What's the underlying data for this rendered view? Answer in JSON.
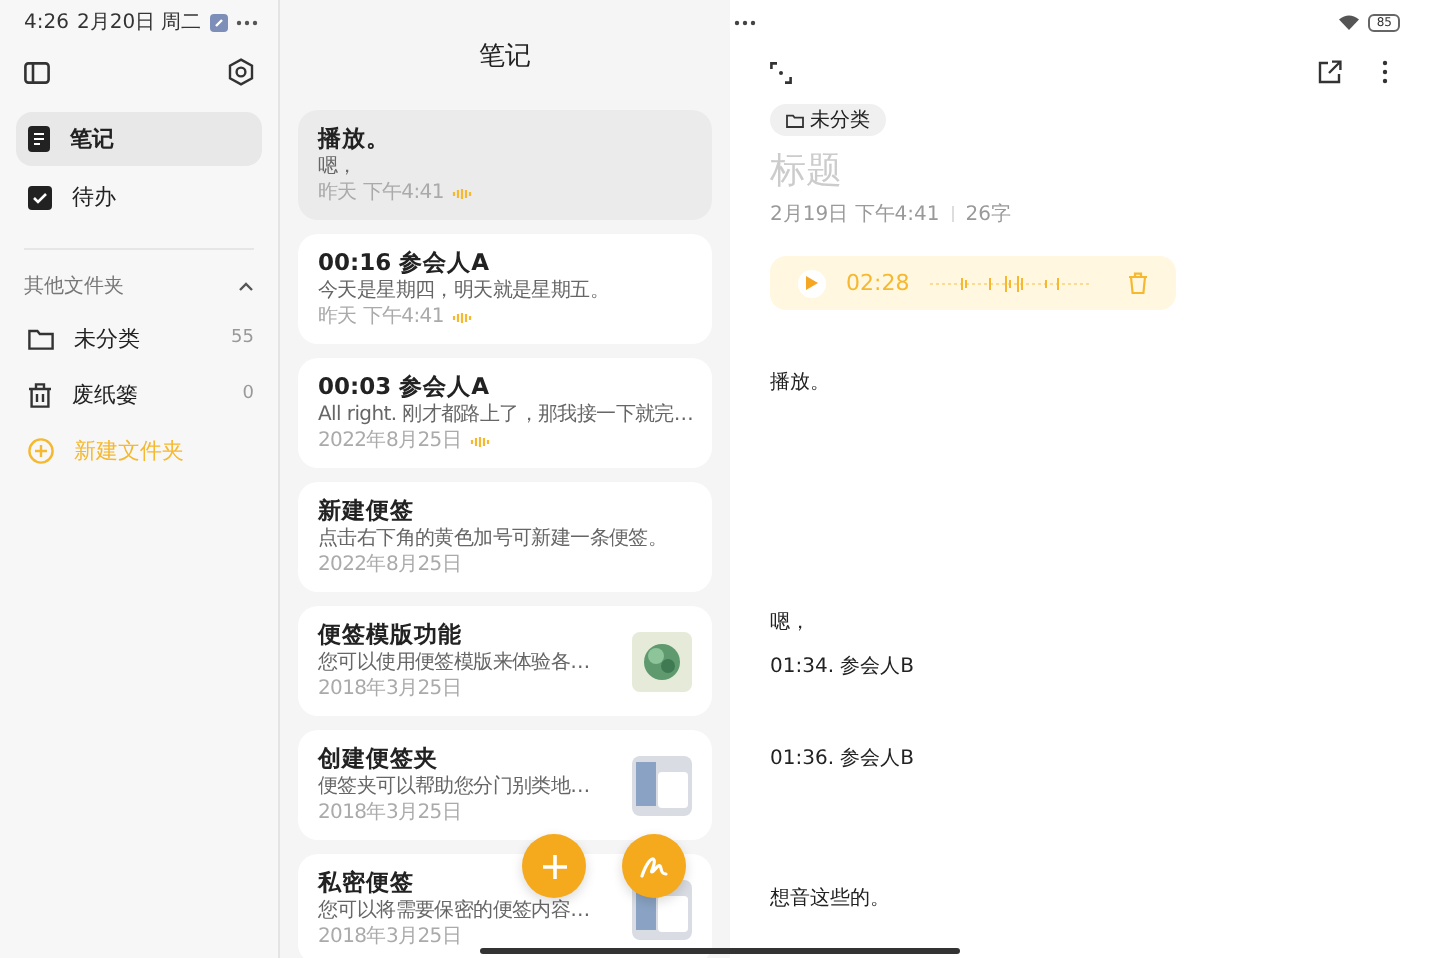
{
  "status_bar": {
    "time": "4:26",
    "date": "2月20日 周二",
    "battery": "85"
  },
  "sidebar": {
    "items": [
      {
        "label": "笔记",
        "kind": "note",
        "selected": true
      },
      {
        "label": "待办",
        "kind": "todo",
        "selected": false
      }
    ],
    "folders_header": {
      "label": "其他文件夹",
      "expanded": true
    },
    "folders": [
      {
        "label": "未分类",
        "count": "55",
        "kind": "folder"
      },
      {
        "label": "废纸篓",
        "count": "0",
        "kind": "trash"
      }
    ],
    "new_folder": "新建文件夹"
  },
  "list": {
    "title": "笔记",
    "notes": [
      {
        "title": "播放。",
        "preview": "嗯，",
        "date": "昨天 下午4:41",
        "audio": true,
        "selected": true
      },
      {
        "title": "00:16 参会人A",
        "preview": "今天是星期四，明天就是星期五。",
        "date": "昨天 下午4:41",
        "audio": true,
        "selected": false
      },
      {
        "title": "00:03 参会人A",
        "preview": "All right. 刚才都路上了，那我接一下就完…",
        "date": "2022年8月25日",
        "audio": true,
        "selected": false
      },
      {
        "title": "新建便签",
        "preview": "点击右下角的黄色加号可新建一条便签。",
        "date": "2022年8月25日",
        "audio": false,
        "selected": false
      },
      {
        "title": "便签模版功能",
        "preview": "您可以使用便签模版来体验各…",
        "date": "2018年3月25日",
        "audio": false,
        "kind": "plant",
        "selected": false
      },
      {
        "title": "创建便签夹",
        "preview": "便签夹可以帮助您分门别类地…",
        "date": "2018年3月25日",
        "audio": false,
        "kind": "screenshot",
        "selected": false
      },
      {
        "title": "私密便签",
        "preview": "您可以将需要保密的便签内容…",
        "date": "2018年3月25日",
        "audio": false,
        "kind": "screenshot",
        "selected": false
      }
    ]
  },
  "editor": {
    "folder": "未分类",
    "title_placeholder": "标题",
    "date": "2月19日 下午4:41",
    "word_count": "26字",
    "audio": {
      "duration": "02:28",
      "playing": false
    },
    "paragraphs": [
      "播放。",
      "嗯，",
      "01:34. 参会人B",
      "01:36. 参会人B",
      "想音这些的。"
    ]
  }
}
